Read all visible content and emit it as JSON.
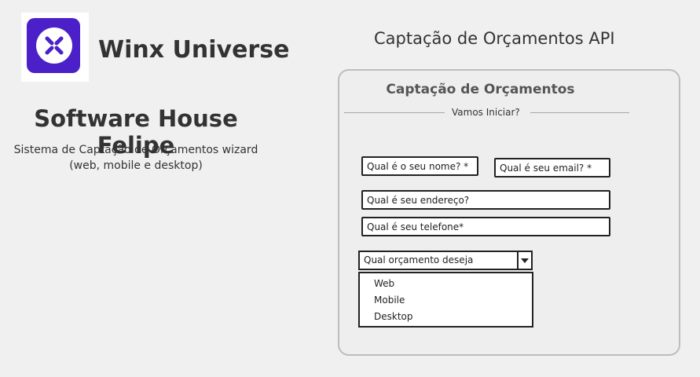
{
  "brand": {
    "name": "Winx Universe",
    "logo_color": "#4b20c8"
  },
  "company": {
    "title": "Software House Felipe",
    "description_line1": "Sistema de Captação de Orçamentos wizard",
    "description_line2": "(web, mobile e desktop)"
  },
  "api_title": "Captação de Orçamentos API",
  "form": {
    "heading": "Captação de Orçamentos",
    "subtitle": "Vamos Iniciar?",
    "name_placeholder": "Qual é o seu nome? *",
    "email_placeholder": "Qual é seu email? *",
    "address_placeholder": "Qual é seu endereço?",
    "phone_placeholder": "Qual é seu telefone*",
    "budget_select": "Qual orçamento deseja realizar?",
    "budget_options": [
      "Web",
      "Mobile",
      "Desktop"
    ]
  }
}
